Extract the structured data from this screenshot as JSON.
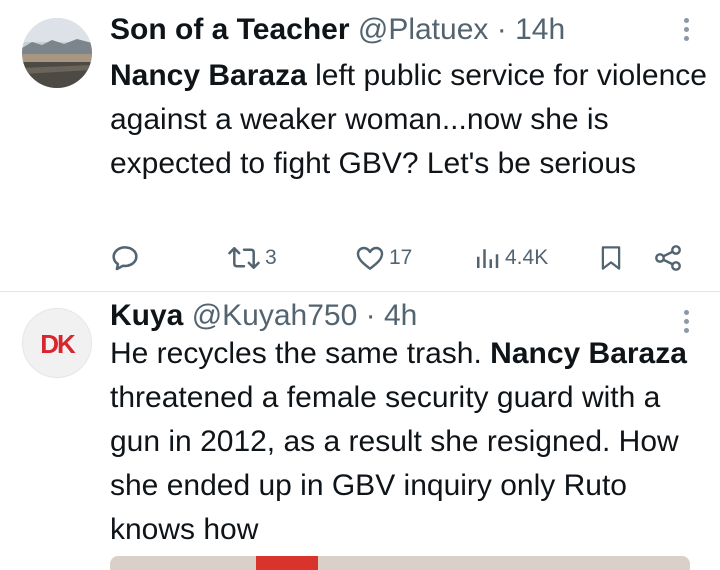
{
  "tweets": [
    {
      "name": "Son of a Teacher",
      "handle": "@Platuex",
      "separator": "·",
      "time": "14h",
      "text_segments": [
        {
          "text": "Nancy Baraza",
          "bold": true
        },
        {
          "text": " left public service for violence against a weaker woman...now she is expected to fight GBV? Let's be serious",
          "bold": false
        }
      ],
      "actions": {
        "reply": {
          "icon": "reply-icon",
          "count": ""
        },
        "retweet": {
          "icon": "retweet-icon",
          "count": "3"
        },
        "like": {
          "icon": "heart-icon",
          "count": "17"
        },
        "views": {
          "icon": "views-icon",
          "count": "4.4K"
        },
        "bookmark": {
          "icon": "bookmark-icon"
        },
        "share": {
          "icon": "share-icon"
        }
      }
    },
    {
      "name": "Kuya",
      "handle": "@Kuyah750",
      "separator": "·",
      "time": "4h",
      "avatar_text": "DK",
      "text_segments": [
        {
          "text": "He  recycles the same trash. ",
          "bold": false
        },
        {
          "text": "Nancy Baraza",
          "bold": true
        },
        {
          "text": " threatened a female security guard with a gun in 2012, as a result she resigned. How she ended up in GBV inquiry only Ruto knows how",
          "bold": false
        }
      ]
    }
  ],
  "colors": {
    "text": "#0f1419",
    "secondary": "#536471",
    "divider": "#e1e6ea",
    "avatar_dk": "#d8262e"
  }
}
